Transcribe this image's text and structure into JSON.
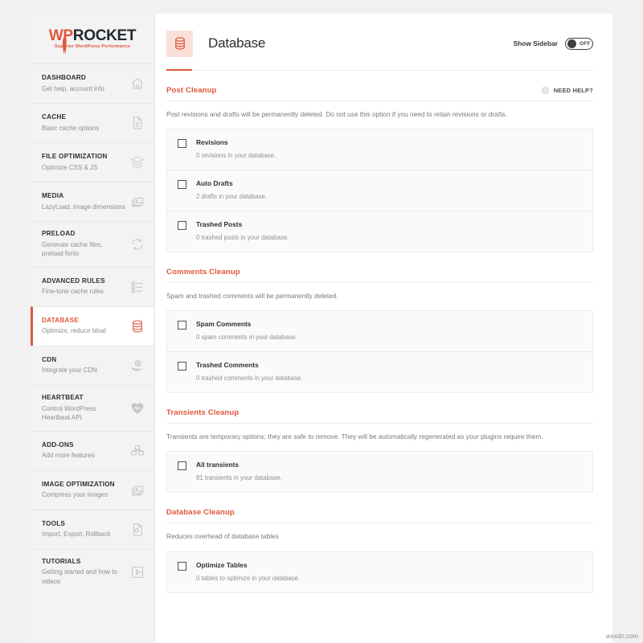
{
  "brand": {
    "name_primary": "WP",
    "name_secondary": "ROCKET",
    "tagline": "Superior WordPress Performance",
    "accent_color": "#e1563d"
  },
  "sidebar": {
    "items": [
      {
        "title": "DASHBOARD",
        "subtitle": "Get help, account info",
        "icon": "home-icon",
        "active": false
      },
      {
        "title": "CACHE",
        "subtitle": "Basic cache options",
        "icon": "document-icon",
        "active": false
      },
      {
        "title": "FILE OPTIMIZATION",
        "subtitle": "Optimize CSS & JS",
        "icon": "layers-icon",
        "active": false
      },
      {
        "title": "MEDIA",
        "subtitle": "LazyLoad, image dimensions",
        "icon": "images-icon",
        "active": false
      },
      {
        "title": "PRELOAD",
        "subtitle": "Generate cache files, preload fonts",
        "icon": "refresh-icon",
        "active": false
      },
      {
        "title": "ADVANCED RULES",
        "subtitle": "Fine-tune cache rules",
        "icon": "list-icon",
        "active": false
      },
      {
        "title": "DATABASE",
        "subtitle": "Optimize, reduce bloat",
        "icon": "database-icon",
        "active": true
      },
      {
        "title": "CDN",
        "subtitle": "Integrate your CDN",
        "icon": "cloud-hand-icon",
        "active": false
      },
      {
        "title": "HEARTBEAT",
        "subtitle": "Control WordPress Heartbeat API",
        "icon": "heart-pulse-icon",
        "active": false
      },
      {
        "title": "ADD-ONS",
        "subtitle": "Add more features",
        "icon": "boxes-icon",
        "active": false
      },
      {
        "title": "IMAGE OPTIMIZATION",
        "subtitle": "Compress your images",
        "icon": "image-compress-icon",
        "active": false
      },
      {
        "title": "TOOLS",
        "subtitle": "Import, Export, Rollback",
        "icon": "gear-document-icon",
        "active": false
      },
      {
        "title": "TUTORIALS",
        "subtitle": "Getting started and how to videos",
        "icon": "play-icon",
        "active": false
      }
    ]
  },
  "header": {
    "title": "Database",
    "icon": "database-icon",
    "sidebar_toggle_label": "Show Sidebar",
    "sidebar_toggle_state": "OFF"
  },
  "need_help": {
    "label": "NEED HELP?",
    "icon": "lifebuoy-icon"
  },
  "sections": [
    {
      "title": "Post Cleanup",
      "description": "Post revisions and drafts will be permanently deleted. Do not use this option if you need to retain revisions or drafts.",
      "has_help": true,
      "options": [
        {
          "label": "Revisions",
          "sub": "0 revisions in your database.",
          "checked": false
        },
        {
          "label": "Auto Drafts",
          "sub": "2 drafts in your database.",
          "checked": false
        },
        {
          "label": "Trashed Posts",
          "sub": "0 trashed posts in your database.",
          "checked": false
        }
      ]
    },
    {
      "title": "Comments Cleanup",
      "description": "Spam and trashed comments will be permanently deleted.",
      "has_help": false,
      "options": [
        {
          "label": "Spam Comments",
          "sub": "0 spam comments in your database.",
          "checked": false
        },
        {
          "label": "Trashed Comments",
          "sub": "0 trashed comments in your database.",
          "checked": false
        }
      ]
    },
    {
      "title": "Transients Cleanup",
      "description": "Transients are temporary options; they are safe to remove. They will be automatically regenerated as your plugins require them.",
      "has_help": false,
      "options": [
        {
          "label": "All transients",
          "sub": "81 transients in your database.",
          "checked": false
        }
      ]
    },
    {
      "title": "Database Cleanup",
      "description": "Reduces overhead of database tables",
      "has_help": false,
      "options": [
        {
          "label": "Optimize Tables",
          "sub": "0 tables to optimize in your database.",
          "checked": false
        }
      ]
    }
  ],
  "watermark": "wsxdn.com"
}
